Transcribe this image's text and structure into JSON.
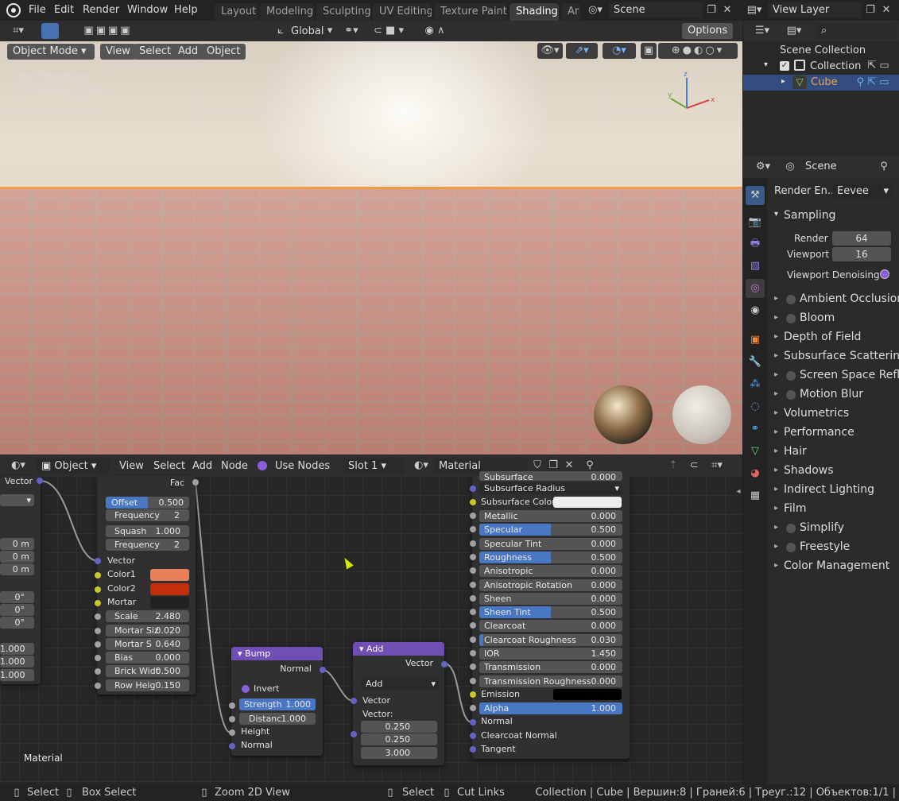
{
  "menu": [
    "File",
    "Edit",
    "Render",
    "Window",
    "Help"
  ],
  "workspace_tabs": [
    "Layout",
    "Modeling",
    "Sculpting",
    "UV Editing",
    "Texture Paint",
    "Shading",
    "Ar"
  ],
  "active_tab": "Shading",
  "scene_field": "Scene",
  "view_layer_field": "View Layer",
  "viewport": {
    "mode": "Object Mode",
    "menus": [
      "View",
      "Select",
      "Add",
      "Object"
    ],
    "orientation": "Global",
    "options": "Options",
    "overlay_line1": "User Perspective",
    "overlay_line2": "(1) Collection | Cube",
    "gizmo_x": "x",
    "gizmo_y": "y",
    "gizmo_z": "z"
  },
  "node_editor": {
    "type": "Object",
    "menus": [
      "View",
      "Select",
      "Add",
      "Node"
    ],
    "use_nodes": "Use Nodes",
    "slot": "Slot 1",
    "material": "Material",
    "footer": "Material",
    "left_node": {
      "vector": "Vector",
      "values": [
        "0 m",
        "0 m",
        "0 m",
        "0°",
        "0°",
        "0°",
        "1.000",
        "1.000",
        "1.000"
      ]
    },
    "brick": {
      "fac": "Fac",
      "offset": {
        "label": "Offset",
        "value": "0.500"
      },
      "frequency1": {
        "label": "Frequency",
        "value": "2"
      },
      "squash": {
        "label": "Squash",
        "value": "1.000"
      },
      "frequency2": {
        "label": "Frequency",
        "value": "2"
      },
      "vector": "Vector",
      "color1": {
        "label": "Color1",
        "color": "#e9805a"
      },
      "color2": {
        "label": "Color2",
        "color": "#c32f0a"
      },
      "mortar": {
        "label": "Mortar",
        "color": "#222222"
      },
      "scale": {
        "label": "Scale",
        "value": "2.480"
      },
      "mortar_size": {
        "label": "Mortar Siz",
        "value": "0.020"
      },
      "mortar_smooth": {
        "label": "Mortar S",
        "value": "0.640"
      },
      "bias": {
        "label": "Bias",
        "value": "0.000"
      },
      "brick_width": {
        "label": "Brick Widt",
        "value": "0.500"
      },
      "row_height": {
        "label": "Row Heig",
        "value": "0.150"
      }
    },
    "bump": {
      "title": "Bump",
      "normal_out": "Normal",
      "invert": "Invert",
      "strength": {
        "label": "Strength",
        "value": "1.000"
      },
      "distance": {
        "label": "Distanc",
        "value": "1.000"
      },
      "height": "Height",
      "normal_in": "Normal"
    },
    "add": {
      "title": "Add",
      "vector_out": "Vector",
      "operation": "Add",
      "vector_in": "Vector",
      "vector_label": "Vector:",
      "values": [
        "0.250",
        "0.250",
        "3.000"
      ]
    },
    "bsdf": {
      "cut_row": {
        "label": "Subsurface",
        "value": "0.000"
      },
      "subsurface_method": "Subsurface Radius",
      "subsurface_color": "Subsurface Color",
      "rows": [
        {
          "label": "Metallic",
          "value": "0.000",
          "fill": 0
        },
        {
          "label": "Specular",
          "value": "0.500",
          "fill": 0.5
        },
        {
          "label": "Specular Tint",
          "value": "0.000",
          "fill": 0
        },
        {
          "label": "Roughness",
          "value": "0.500",
          "fill": 0.5
        },
        {
          "label": "Anisotropic",
          "value": "0.000",
          "fill": 0
        },
        {
          "label": "Anisotropic Rotation",
          "value": "0.000",
          "fill": 0
        },
        {
          "label": "Sheen",
          "value": "0.000",
          "fill": 0
        },
        {
          "label": "Sheen Tint",
          "value": "0.500",
          "fill": 0.5
        },
        {
          "label": "Clearcoat",
          "value": "0.000",
          "fill": 0
        },
        {
          "label": "Clearcoat Roughness",
          "value": "0.030",
          "fill": 0.03
        },
        {
          "label": "IOR",
          "value": "1.450",
          "fill": 0
        },
        {
          "label": "Transmission",
          "value": "0.000",
          "fill": 0
        },
        {
          "label": "Transmission Roughness",
          "value": "0.000",
          "fill": 0
        }
      ],
      "emission": "Emission",
      "alpha": {
        "label": "Alpha",
        "value": "1.000",
        "fill": 1
      },
      "normal": "Normal",
      "clearcoat_normal": "Clearcoat Normal",
      "tangent": "Tangent"
    }
  },
  "outliner": {
    "scene_collection": "Scene Collection",
    "collection": "Collection",
    "cube": "Cube"
  },
  "properties": {
    "context": "Scene",
    "render_engine_label": "Render En...",
    "render_engine": "Eevee",
    "sampling": "Sampling",
    "render_label": "Render",
    "render_value": "64",
    "viewport_label": "Viewport",
    "viewport_value": "16",
    "viewport_denoising": "Viewport Denoising",
    "panels": [
      {
        "label": "Ambient Occlusion",
        "check": true
      },
      {
        "label": "Bloom",
        "check": true
      },
      {
        "label": "Depth of Field",
        "check": false
      },
      {
        "label": "Subsurface Scattering",
        "check": false
      },
      {
        "label": "Screen Space Refle",
        "check": true
      },
      {
        "label": "Motion Blur",
        "check": true
      },
      {
        "label": "Volumetrics",
        "check": false
      },
      {
        "label": "Performance",
        "check": false
      },
      {
        "label": "Hair",
        "check": false
      },
      {
        "label": "Shadows",
        "check": false
      },
      {
        "label": "Indirect Lighting",
        "check": false
      },
      {
        "label": "Film",
        "check": false
      },
      {
        "label": "Simplify",
        "check": true
      },
      {
        "label": "Freestyle",
        "check": true
      },
      {
        "label": "Color Management",
        "check": false
      }
    ]
  },
  "status_bar": {
    "select": "Select",
    "box_select": "Box Select",
    "zoom": "Zoom 2D View",
    "select2": "Select",
    "cut_links": "Cut Links",
    "stats": "Collection | Cube | Вершин:8 | Граней:6 | Треуг.:12 | Объектов:1/1 |"
  },
  "colors": {
    "accent": "#4772b3",
    "node_header": "#6f4fb3",
    "active_outliner": "#334d80"
  }
}
